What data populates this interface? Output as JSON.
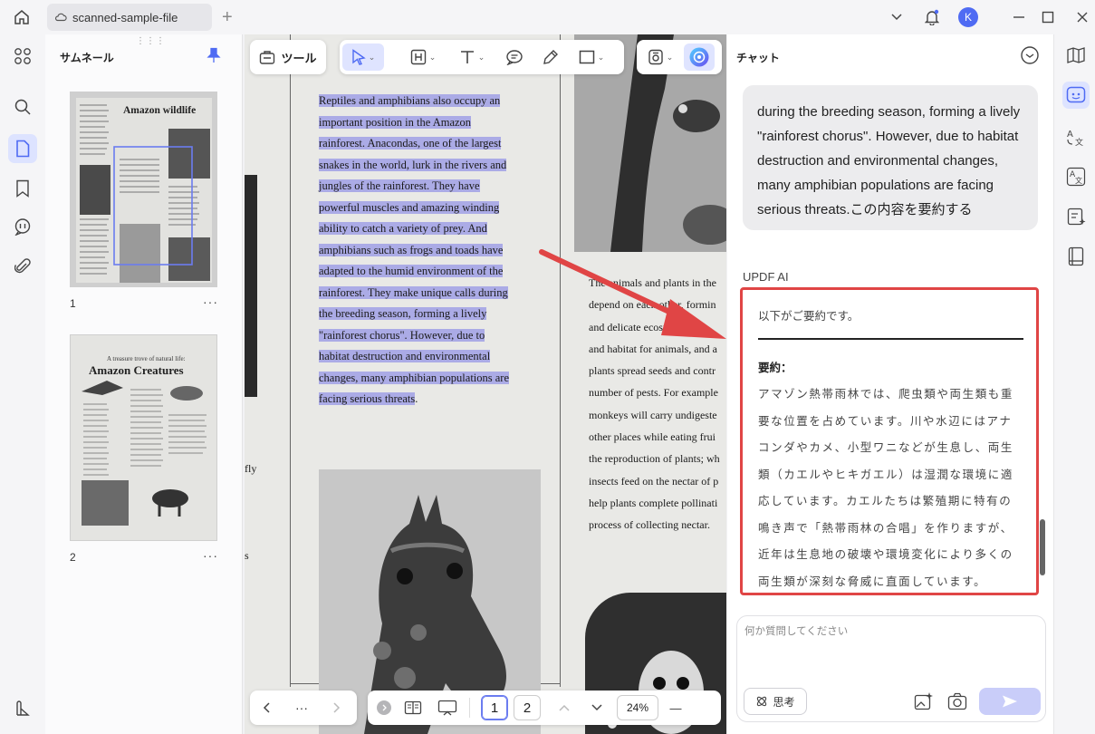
{
  "titlebar": {
    "tab_name": "scanned-sample-file",
    "avatar_initial": "K"
  },
  "thumbnails": {
    "title": "サムネール",
    "pages": [
      {
        "number": "1",
        "heading": "Amazon wildlife"
      },
      {
        "number": "2",
        "subheading": "A treasure trove of natural life:",
        "heading": "Amazon Creatures"
      }
    ],
    "more": "···"
  },
  "toolbar": {
    "tools_label": "ツール"
  },
  "document": {
    "highlighted_lines": [
      "Reptiles and amphibians also occupy an",
      "important position in the Amazon",
      "rainforest. Anacondas, one of the largest",
      "snakes in the world, lurk in the rivers and",
      "jungles of the rainforest. They have",
      "powerful muscles and amazing winding",
      "ability to catch a variety of prey. And",
      "amphibians such as frogs and toads have",
      "adapted to the humid environment of the",
      "rainforest. They make unique calls during",
      "the breeding season, forming a lively",
      "\"rainforest chorus\". However, due to",
      "habitat destruction and environmental",
      "changes, many amphibian populations are",
      "facing serious threats"
    ],
    "highlight_tail": ".",
    "right_column_lines": [
      "The animals and plants in the",
      "depend on each other, formin",
      "and delicate ecosyste",
      "and habitat for animals, and a",
      "plants spread seeds and contr",
      "number of pests. For example",
      "monkeys will carry undigeste",
      "other places while eating frui",
      "the reproduction of plants; wh",
      "insects feed on the nectar of p",
      "help plants complete pollinati",
      "process of collecting nectar."
    ],
    "left_fragments": [
      "fly",
      "s"
    ]
  },
  "navbar": {
    "more": "···",
    "pages": [
      "1",
      "2"
    ],
    "zoom": "24%",
    "zoom_out": "—"
  },
  "chat": {
    "title": "チャット",
    "user_message": "during the breeding season, forming a lively \"rainforest chorus\". However, due to habitat destruction and environmental changes, many amphibian populations are facing serious threats.この内容を要約する",
    "ai_label": "UPDF AI",
    "ai_intro": "以下がご要約です。",
    "ai_heading": "要約：",
    "ai_body": "アマゾン熱帯雨林では、爬虫類や両生類も重要な位置を占めています。川や水辺にはアナコンダやカメ、小型ワニなどが生息し、両生類（カエルやヒキガエル）は湿潤な環境に適応しています。カエルたちは繁殖期に特有の鳴き声で「熱帯雨林の合唱」を作りますが、近年は生息地の破壊や環境変化により多くの両生類が深刻な脅威に直面しています。",
    "input_placeholder": "何か質問してください",
    "think_label": "思考"
  },
  "colors": {
    "accent": "#4f6bf3",
    "highlight": "#7878e6",
    "annotation_red": "#e04545",
    "send_button": "#c9cdf9"
  }
}
